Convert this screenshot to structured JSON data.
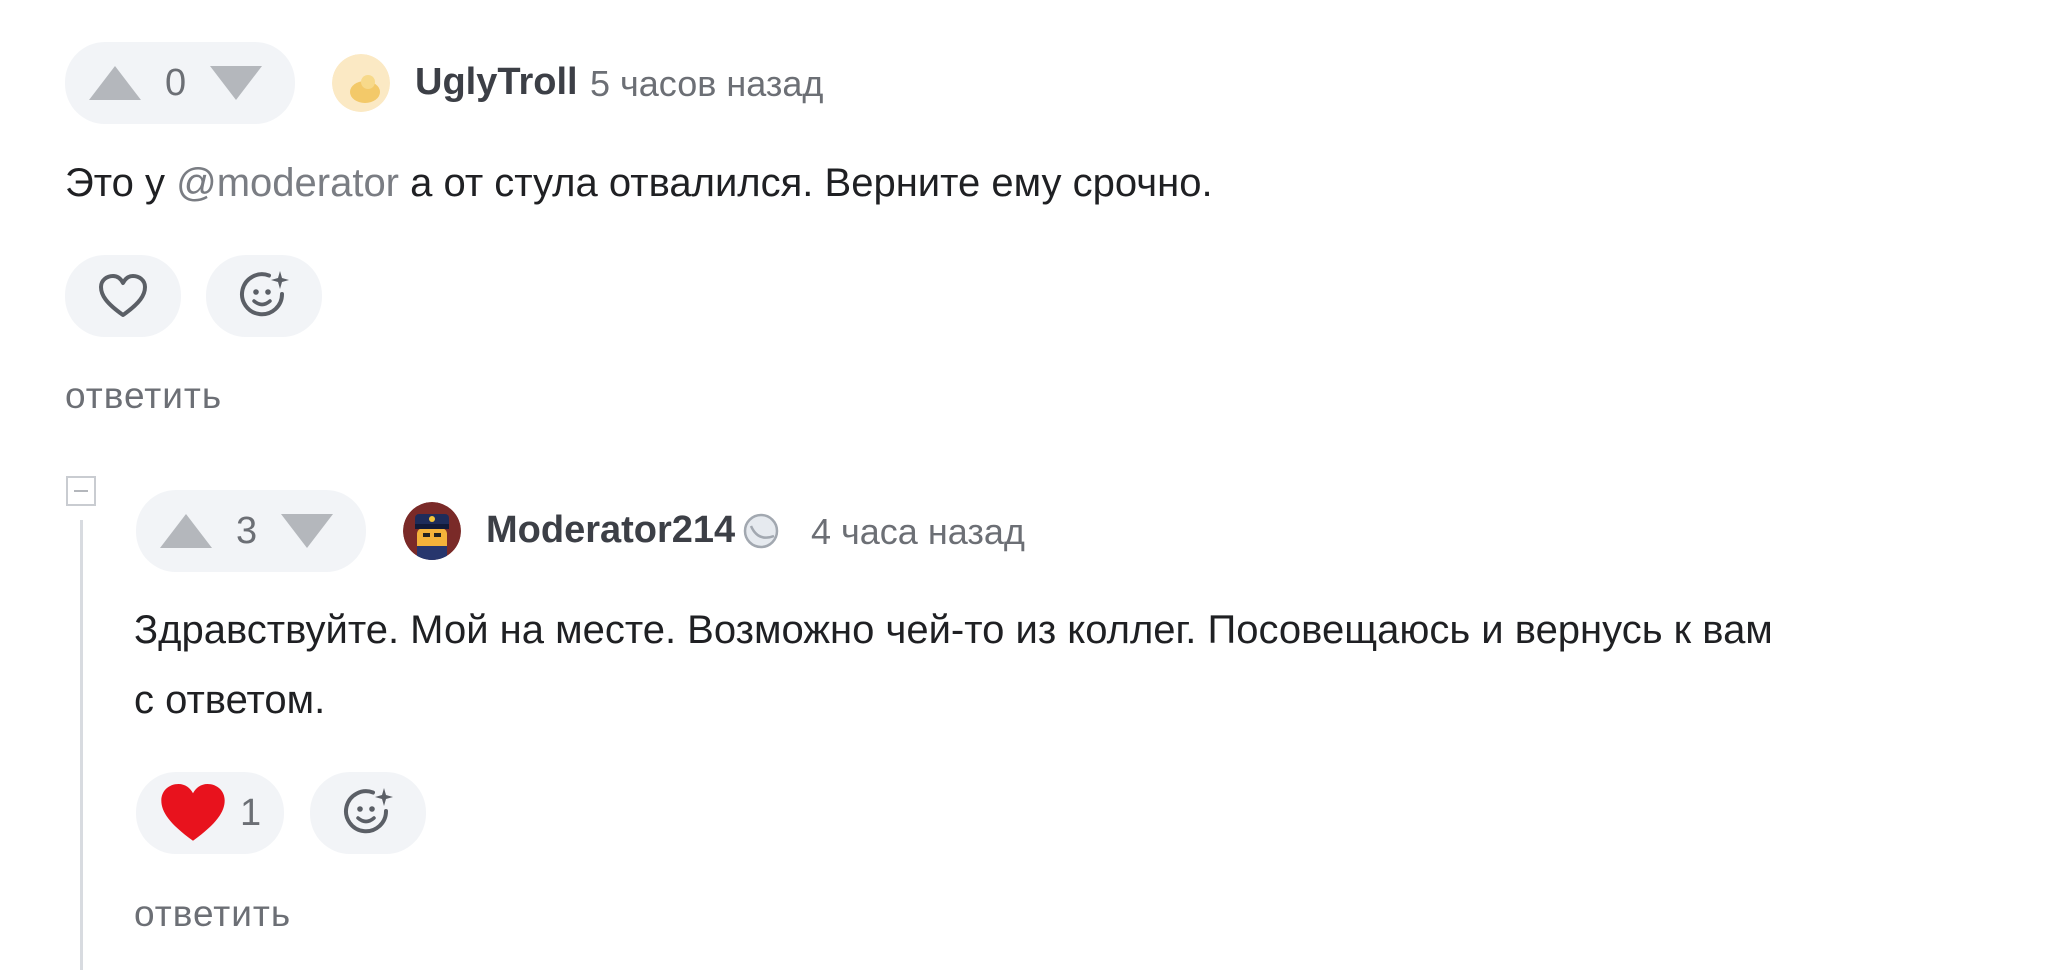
{
  "comments": [
    {
      "votes": "0",
      "username": "UglyTroll",
      "time": "5 часов назад",
      "text_before": "Это у ",
      "mention": "@moderator",
      "text_after": " а от стула отвалился. Верните ему срочно.",
      "reply_label": "ответить"
    },
    {
      "votes": "3",
      "username": "Moderator214",
      "time": "4 часа назад",
      "text_line1": "Здравствуйте. Мой на месте. Возможно чей-то из коллег. Посовещаюсь и вернусь к вам",
      "text_line2": "с ответом.",
      "likes": "1",
      "reply_label": "ответить"
    }
  ],
  "colors": {
    "pill_background": "#f2f4f7",
    "liked_heart": "#e8121d",
    "muted_text": "#6c6f75"
  }
}
